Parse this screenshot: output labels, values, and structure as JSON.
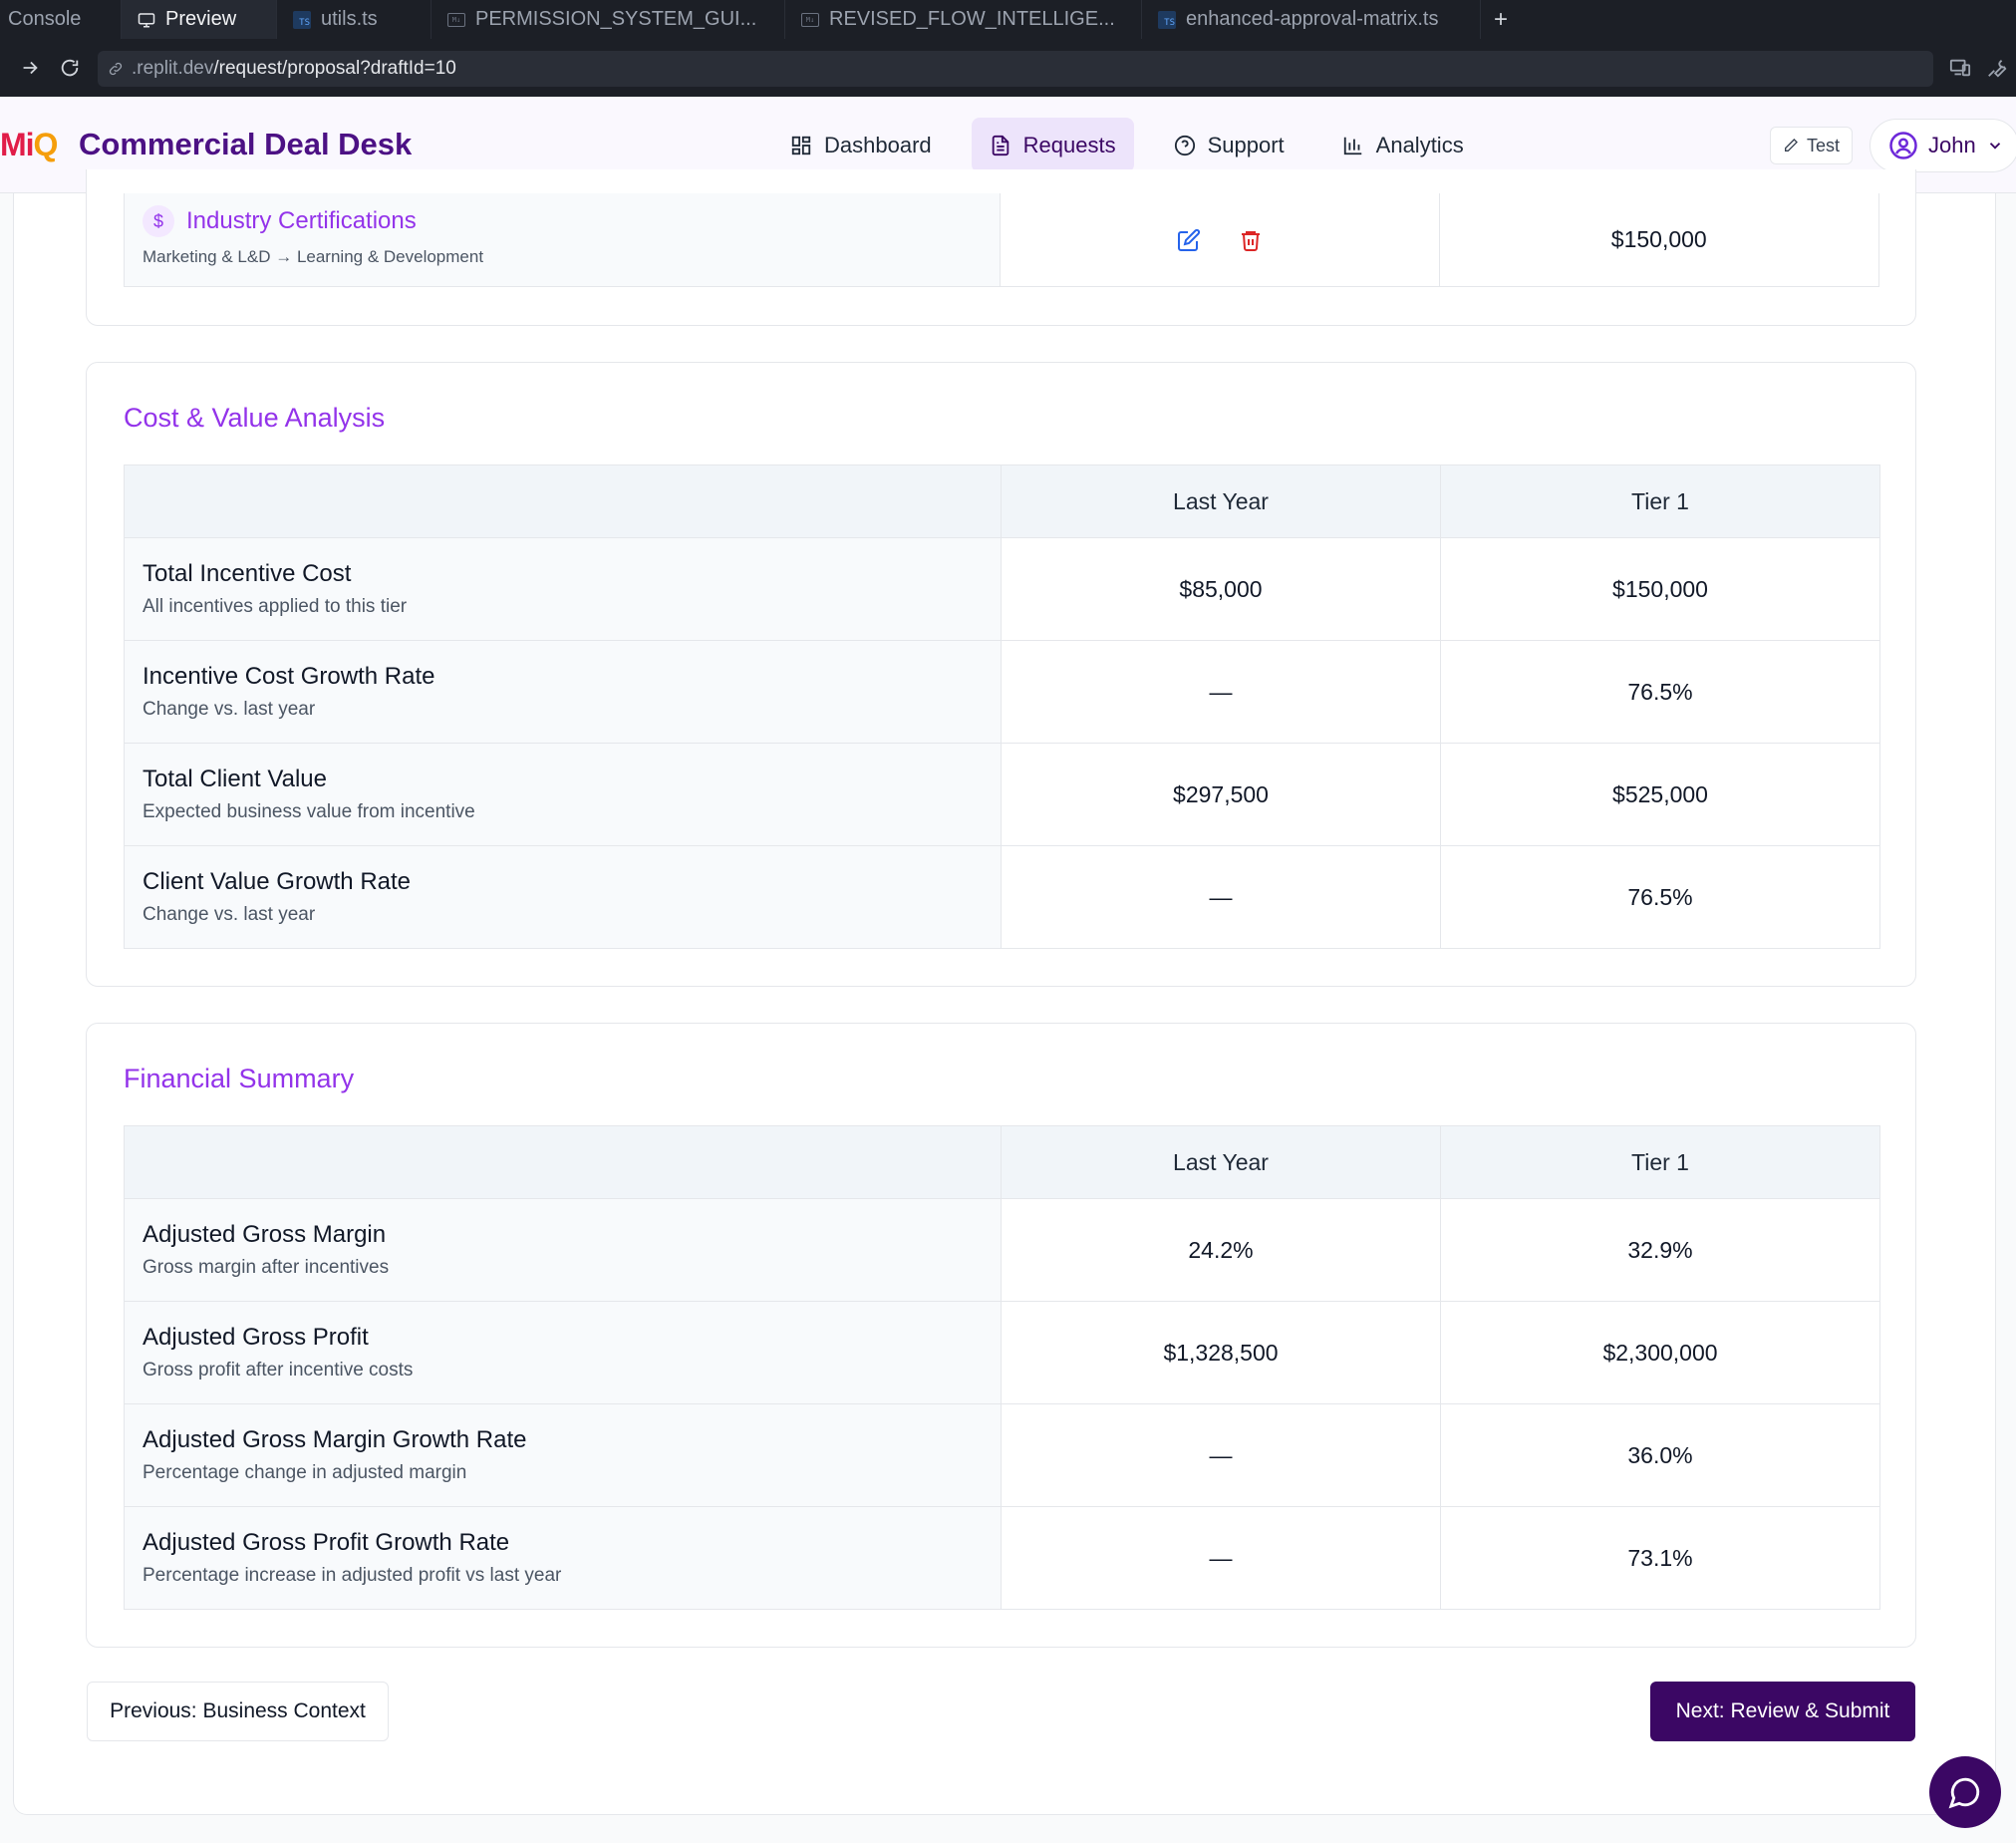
{
  "browser": {
    "tabs": [
      {
        "label": "Console",
        "icon": "none"
      },
      {
        "label": "Preview",
        "icon": "monitor-icon"
      },
      {
        "label": "utils.ts",
        "icon": "ts-file-icon"
      },
      {
        "label": "PERMISSION_SYSTEM_GUI...",
        "icon": "md-file-icon"
      },
      {
        "label": "REVISED_FLOW_INTELLIGE...",
        "icon": "md-file-icon"
      },
      {
        "label": "enhanced-approval-matrix.ts",
        "icon": "ts-file-icon"
      }
    ],
    "new_tab": "+",
    "url_host": ".replit.dev",
    "url_path": "/request/proposal?draftId=10"
  },
  "header": {
    "logo_part1": "Mi",
    "logo_part2": "Q",
    "brand": "Commercial Deal Desk",
    "nav": [
      {
        "label": "Dashboard",
        "icon": "dashboard-icon",
        "active": false
      },
      {
        "label": "Requests",
        "icon": "document-icon",
        "active": true
      },
      {
        "label": "Support",
        "icon": "help-circle-icon",
        "active": false
      },
      {
        "label": "Analytics",
        "icon": "bar-chart-icon",
        "active": false
      }
    ],
    "test_label": "Test",
    "user_name": "John"
  },
  "incentive": {
    "title": "Industry Certifications",
    "subtitle": "Marketing & L&D → Learning & Development",
    "value": "$150,000"
  },
  "cost_value": {
    "title": "Cost & Value Analysis",
    "headers": [
      "",
      "Last Year",
      "Tier 1"
    ],
    "rows": [
      {
        "title": "Total Incentive Cost",
        "sub": "All incentives applied to this tier",
        "last": "$85,000",
        "tier": "$150,000",
        "tier_status": "neutral"
      },
      {
        "title": "Incentive Cost Growth Rate",
        "sub": "Change vs. last year",
        "last": "—",
        "tier": "76.5%",
        "tier_status": "negative"
      },
      {
        "title": "Total Client Value",
        "sub": "Expected business value from incentive",
        "last": "$297,500",
        "tier": "$525,000",
        "tier_status": "neutral"
      },
      {
        "title": "Client Value Growth Rate",
        "sub": "Change vs. last year",
        "last": "—",
        "tier": "76.5%",
        "tier_status": "positive"
      }
    ]
  },
  "financial": {
    "title": "Financial Summary",
    "headers": [
      "",
      "Last Year",
      "Tier 1"
    ],
    "rows": [
      {
        "title": "Adjusted Gross Margin",
        "sub": "Gross margin after incentives",
        "last": "24.2%",
        "tier": "32.9%",
        "tier_status": "neutral"
      },
      {
        "title": "Adjusted Gross Profit",
        "sub": "Gross profit after incentive costs",
        "last": "$1,328,500",
        "tier": "$2,300,000",
        "tier_status": "neutral"
      },
      {
        "title": "Adjusted Gross Margin Growth Rate",
        "sub": "Percentage change in adjusted margin",
        "last": "—",
        "tier": "36.0%",
        "tier_status": "positive"
      },
      {
        "title": "Adjusted Gross Profit Growth Rate",
        "sub": "Percentage increase in adjusted profit vs last year",
        "last": "—",
        "tier": "73.1%",
        "tier_status": "positive"
      }
    ]
  },
  "footer": {
    "prev_label": "Previous: Business Context",
    "next_label": "Next: Review & Submit"
  },
  "colors": {
    "brand_purple": "#4c1184",
    "accent_purple": "#9333ea",
    "primary_button": "#3b0764",
    "positive": "#16a34a",
    "negative": "#dc2626"
  }
}
